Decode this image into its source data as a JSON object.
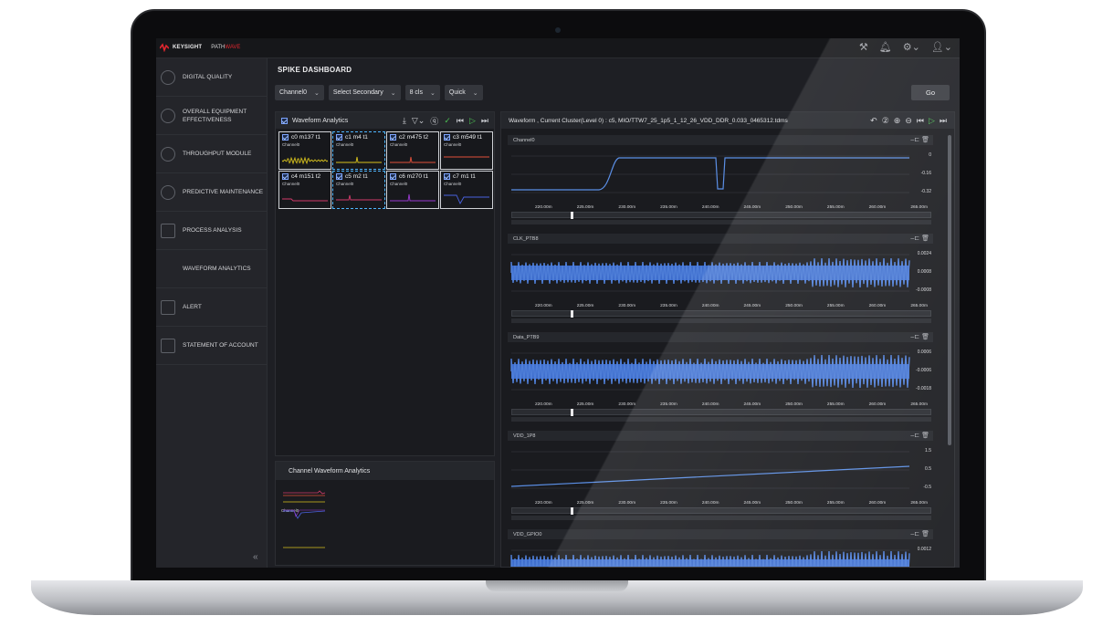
{
  "brand": {
    "name": "KEYSIGHT",
    "product_prefix": "PATH",
    "product_suffix": "WAVE"
  },
  "topbar": {
    "icons": [
      "wrench-icon",
      "bell-icon",
      "gear-icon",
      "user-icon"
    ]
  },
  "sidebar": {
    "items": [
      {
        "label": "DIGITAL QUALITY",
        "icon": "gauge-icon"
      },
      {
        "label": "OVERALL EQUIPMENT EFFECTIVENESS",
        "icon": "gauge-icon"
      },
      {
        "label": "THROUGHPUT MODULE",
        "icon": "cycle-icon"
      },
      {
        "label": "PREDICTIVE MAINTENANCE",
        "icon": "tools-icon"
      },
      {
        "label": "PROCESS ANALYSIS",
        "icon": "flow-icon"
      },
      {
        "label": "WAVEFORM ANALYTICS",
        "icon": ""
      },
      {
        "label": "ALERT",
        "icon": "alert-icon"
      },
      {
        "label": "STATEMENT OF ACCOUNT",
        "icon": "document-icon"
      }
    ],
    "collapse_icon": "double-chevron-left-icon"
  },
  "page": {
    "title": "SPIKE DASHBOARD"
  },
  "filters": {
    "channel": "Channel0",
    "secondary": "Select Secondary",
    "clusters": "8 cls",
    "mode": "Quick",
    "go": "Go"
  },
  "waveform_analytics": {
    "title": "Waveform Analytics",
    "clusters": [
      {
        "label": "c0 m137 t1",
        "channel": "Channel0",
        "color": "#d8c21c"
      },
      {
        "label": "c1 m4 t1",
        "channel": "Channel0",
        "color": "#d8c21c"
      },
      {
        "label": "c2 m475 t2",
        "channel": "Channel0",
        "color": "#e0503a"
      },
      {
        "label": "c3 m549 t1",
        "channel": "Channel0",
        "color": "#e0503a"
      },
      {
        "label": "c4 m151 t2",
        "channel": "Channel0",
        "color": "#d13a6a"
      },
      {
        "label": "c5 m2 t1",
        "channel": "Channel0",
        "color": "#d13a6a"
      },
      {
        "label": "c6 m270 t1",
        "channel": "Channel0",
        "color": "#9a3ad1"
      },
      {
        "label": "c7 m1 t1",
        "channel": "Channel0",
        "color": "#4a62e0"
      }
    ]
  },
  "channel_waveform_analytics": {
    "title": "Channel Waveform Analytics",
    "channel_label": "Channel0"
  },
  "waveform_panel": {
    "title": "Waveform , Current Cluster(Level 0) : c5, MIO/TTW7_25_1p5_1_12_26_VDD_DDR_0.033_0465312.tdms",
    "x_ticks": [
      "220.00m",
      "225.00m",
      "230.00m",
      "235.00m",
      "240.00m",
      "245.00m",
      "250.00m",
      "255.00m",
      "260.00m",
      "265.00m"
    ],
    "channels": [
      {
        "name": "Channel0",
        "y_ticks": [
          "0",
          "-0.16",
          "-0.32"
        ]
      },
      {
        "name": "CLK_PTB8",
        "y_ticks": [
          "0.0024",
          "0.0008",
          "-0.0008"
        ]
      },
      {
        "name": "Data_PTB9",
        "y_ticks": [
          "0.0006",
          "-0.0006",
          "-0.0018"
        ]
      },
      {
        "name": "VDD_1P8",
        "y_ticks": [
          "1.5",
          "0.5",
          "-0.5"
        ]
      },
      {
        "name": "VDD_GPIO0",
        "y_ticks": [
          "0.0012"
        ]
      }
    ]
  }
}
